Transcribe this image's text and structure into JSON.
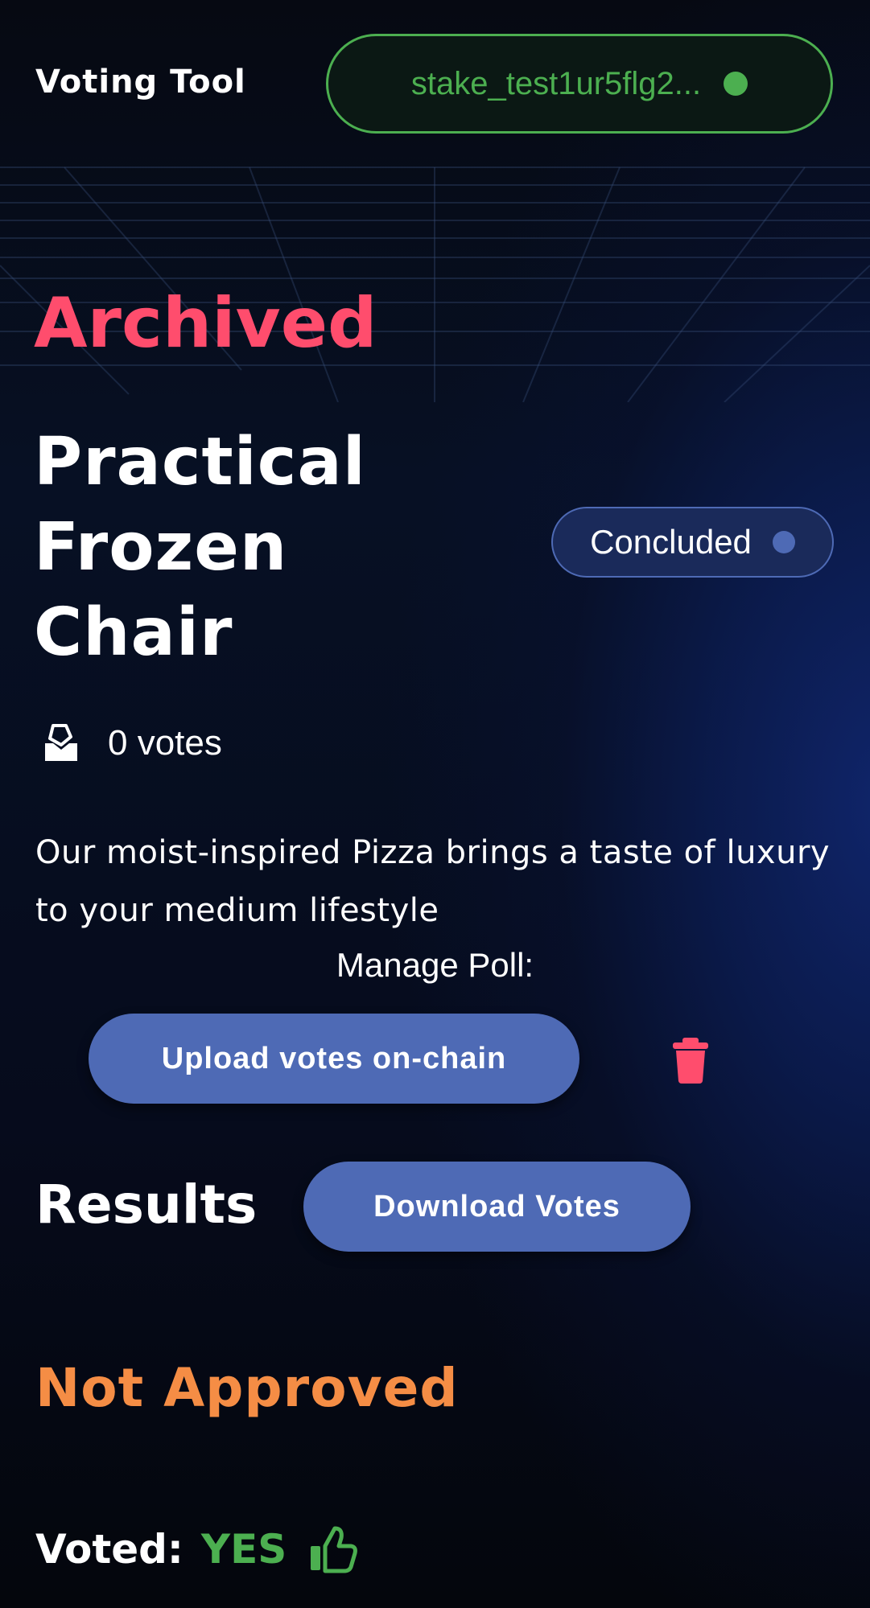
{
  "header": {
    "app_title": "Voting Tool",
    "wallet_address": "stake_test1ur5flg2...",
    "wallet_status_color": "#4caf50"
  },
  "poll": {
    "archived_label": "Archived",
    "title": "Practical Frozen Chair",
    "status": "Concluded",
    "votes": "0 votes",
    "description": "Our moist-inspired Pizza brings a taste of luxury to your medium lifestyle"
  },
  "manage": {
    "label": "Manage Poll:",
    "upload_button": "Upload votes on-chain",
    "delete_icon": "trash-icon"
  },
  "results": {
    "heading": "Results",
    "download_button": "Download Votes",
    "outcome": "Not Approved",
    "voted_label": "Voted:",
    "voted_value": "YES",
    "voted_icon": "thumbs-up-icon"
  },
  "colors": {
    "accent": "#4e6ab5",
    "archived": "#ff4d6d",
    "outcome": "#f58d45",
    "success": "#4caf50"
  }
}
